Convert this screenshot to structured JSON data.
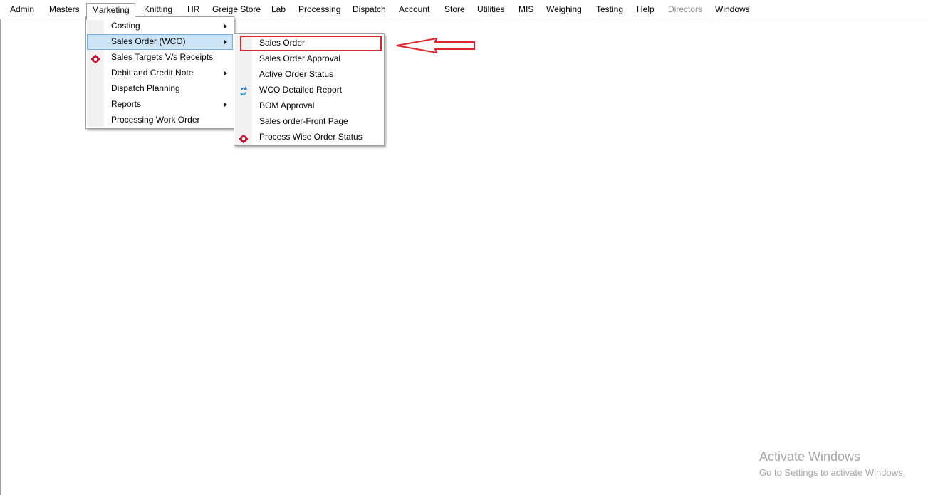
{
  "menubar": {
    "items": [
      {
        "label": "Admin"
      },
      {
        "label": "Masters"
      },
      {
        "label": "Marketing"
      },
      {
        "label": "Knitting"
      },
      {
        "label": "HR"
      },
      {
        "label": "Greige Store"
      },
      {
        "label": "Lab"
      },
      {
        "label": "Processing"
      },
      {
        "label": "Dispatch"
      },
      {
        "label": "Account"
      },
      {
        "label": "Store"
      },
      {
        "label": "Utilities"
      },
      {
        "label": "MIS"
      },
      {
        "label": "Weighing"
      },
      {
        "label": "Testing"
      },
      {
        "label": "Help"
      },
      {
        "label": "Directors",
        "disabled": true
      },
      {
        "label": "Windows"
      }
    ],
    "open_menu": "Marketing"
  },
  "marketing_menu": {
    "items": [
      {
        "label": "Costing",
        "submenu": true
      },
      {
        "label": "Sales Order (WCO)",
        "submenu": true,
        "highlighted": true
      },
      {
        "label": "Sales Targets V/s Receipts",
        "icon": "red-gear-icon"
      },
      {
        "label": "Debit and Credit Note",
        "submenu": true
      },
      {
        "label": "Dispatch Planning"
      },
      {
        "label": "Reports",
        "submenu": true
      },
      {
        "label": "Processing Work Order"
      }
    ]
  },
  "sales_order_submenu": {
    "items": [
      {
        "label": "Sales Order",
        "annotated": true
      },
      {
        "label": "Sales Order Approval"
      },
      {
        "label": "Active Order Status"
      },
      {
        "label": "WCO Detailed Report",
        "icon": "blue-refresh-icon"
      },
      {
        "label": "BOM Approval"
      },
      {
        "label": "Sales order-Front Page"
      },
      {
        "label": "Process Wise Order Status",
        "icon": "red-gear-icon"
      }
    ]
  },
  "colors": {
    "highlight": "#cce4f7",
    "annotation": "#e0242c",
    "watermark": "#a6a6a6"
  },
  "watermark": {
    "title": "Activate Windows",
    "subtitle": "Go to Settings to activate Windows."
  }
}
